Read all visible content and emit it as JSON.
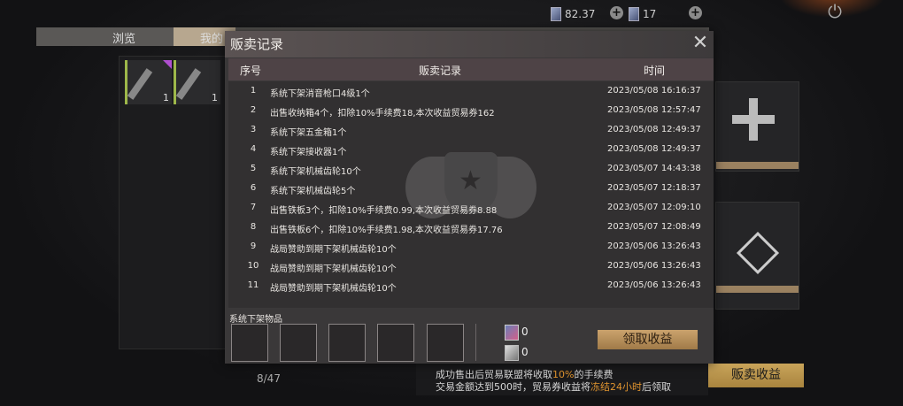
{
  "topbar": {
    "resource1_value": "82.37",
    "resource2_value": "17"
  },
  "bg_tabs": {
    "browse": "浏览",
    "mine": "我的"
  },
  "inventory": {
    "slot1_count": "1",
    "slot2_count": "1",
    "page": "8/47"
  },
  "bottom_bar": {
    "sell_income_button": "贩卖收益",
    "tip_line1_a": "成功售出后贸易联盟将收取",
    "tip_line1_b": "10%",
    "tip_line1_c": "的手续费",
    "tip_line2_a": "交易金额达到500时，贸易券收益将",
    "tip_line2_b": "冻结24小时",
    "tip_line2_c": "后领取"
  },
  "modal": {
    "title": "贩卖记录",
    "columns": {
      "index": "序号",
      "record": "贩卖记录",
      "time": "时间"
    },
    "rows": [
      {
        "idx": "1",
        "record": "系统下架消音枪口4级1个",
        "time": "2023/05/08 16:16:37"
      },
      {
        "idx": "2",
        "record": "出售收纳箱4个，扣除10%手续费18,本次收益贸易券162",
        "time": "2023/05/08 12:57:47"
      },
      {
        "idx": "3",
        "record": "系统下架五金箱1个",
        "time": "2023/05/08 12:49:37"
      },
      {
        "idx": "4",
        "record": "系统下架接收器1个",
        "time": "2023/05/08 12:49:37"
      },
      {
        "idx": "5",
        "record": "系统下架机械齿轮10个",
        "time": "2023/05/07 14:43:38"
      },
      {
        "idx": "6",
        "record": "系统下架机械齿轮5个",
        "time": "2023/05/07 12:18:37"
      },
      {
        "idx": "7",
        "record": "出售铁板3个，扣除10%手续费0.99,本次收益贸易券8.88",
        "time": "2023/05/07 12:09:10"
      },
      {
        "idx": "8",
        "record": "出售铁板6个，扣除10%手续费1.98,本次收益贸易券17.76",
        "time": "2023/05/07 12:08:49"
      },
      {
        "idx": "9",
        "record": "战局赞助到期下架机械齿轮10个",
        "time": "2023/05/06 13:26:43"
      },
      {
        "idx": "10",
        "record": "战局赞助到期下架机械齿轮10个",
        "time": "2023/05/06 13:26:43"
      },
      {
        "idx": "11",
        "record": "战局赞助到期下架机械齿轮10个",
        "time": "2023/05/06 13:26:43"
      }
    ],
    "footer": {
      "label": "系统下架物品",
      "ticket1_value": "0",
      "ticket2_value": "0",
      "claim_button": "领取收益"
    }
  }
}
